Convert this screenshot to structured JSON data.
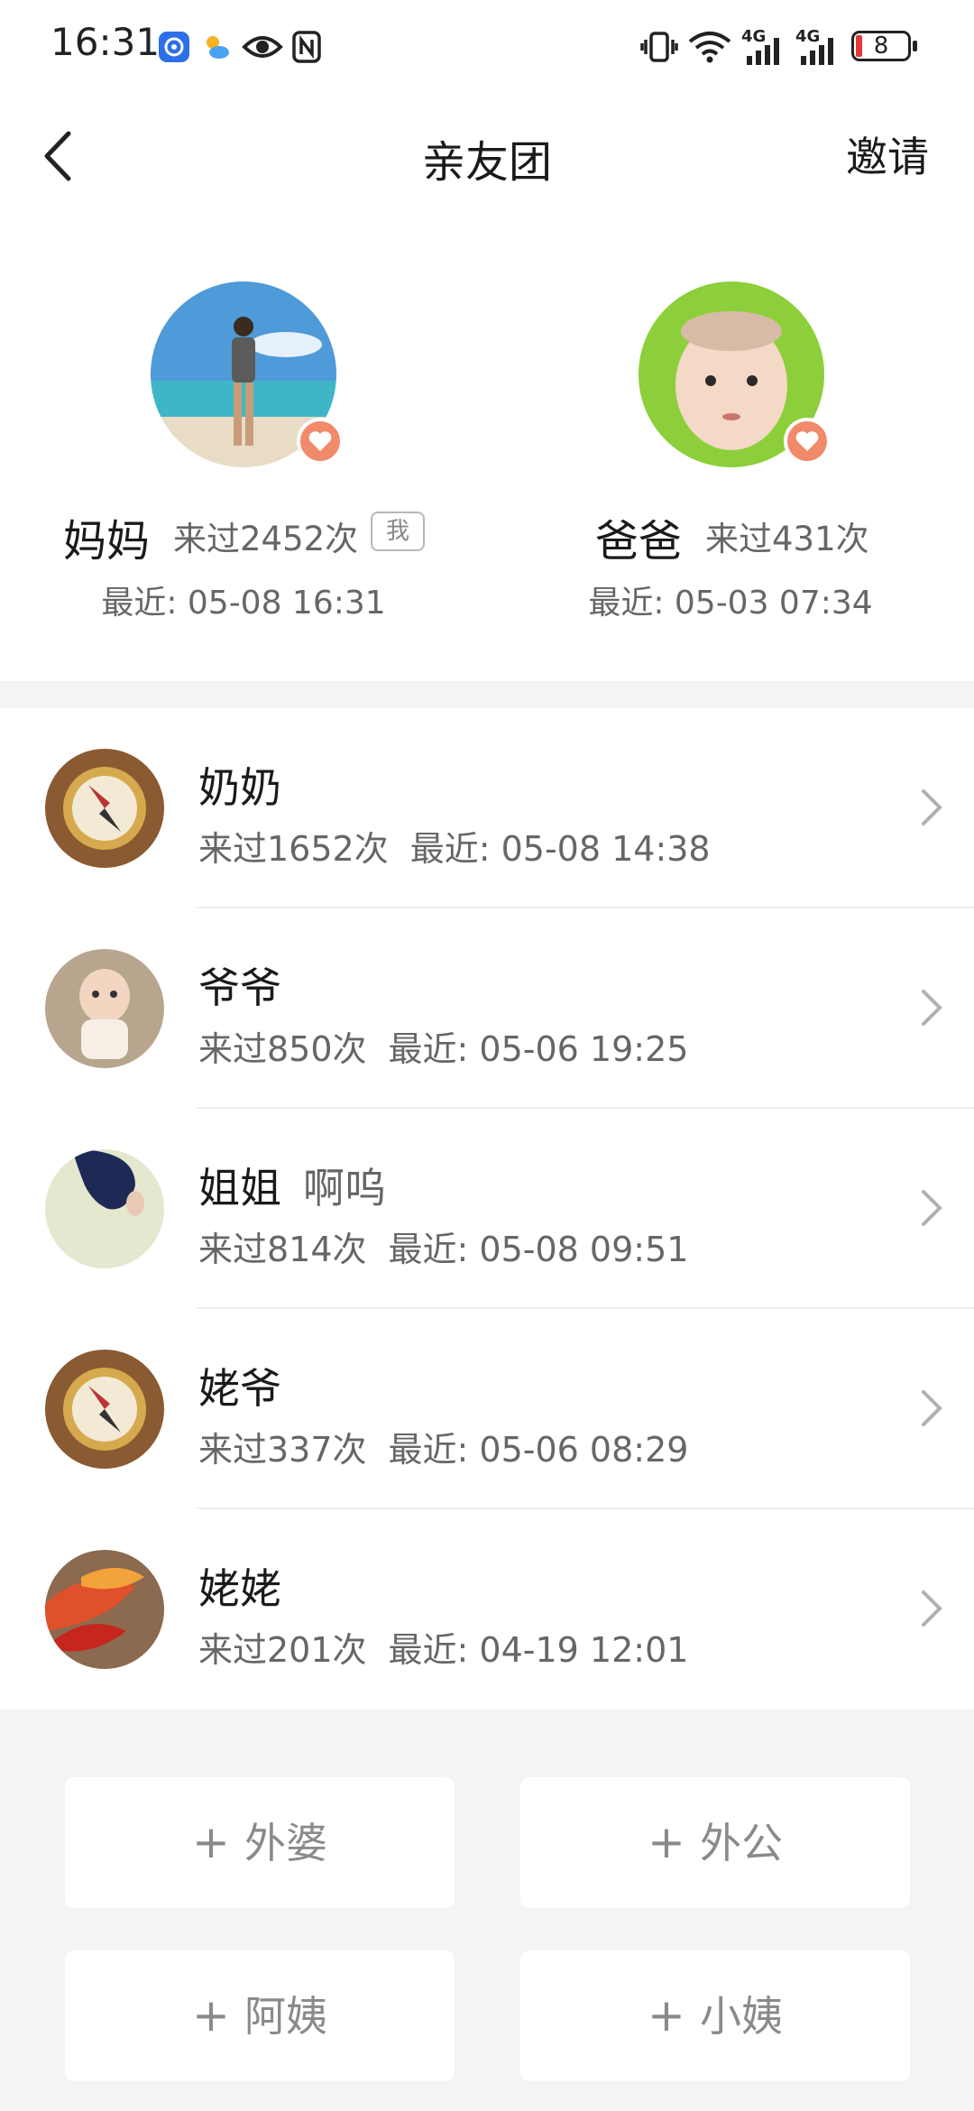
{
  "status_bar": {
    "time": "16:31",
    "icons": [
      "app-badge-icon",
      "weather-icon",
      "eye-icon",
      "nfc-icon",
      "vibrate-icon",
      "wifi-icon",
      "signal-4g-icon",
      "signal-4g-icon",
      "battery-icon"
    ],
    "network1": "4G",
    "network2": "4G",
    "battery": "8"
  },
  "header": {
    "title": "亲友团",
    "invite_label": "邀请"
  },
  "parents": [
    {
      "name": "妈妈",
      "count": "来过2452次",
      "tag": "我",
      "recent": "最近: 05-08 16:31"
    },
    {
      "name": "爸爸",
      "count": "来过431次",
      "recent": "最近: 05-03 07:34"
    }
  ],
  "members": [
    {
      "name": "奶奶",
      "nickname": "",
      "count": "来过1652次",
      "recent": "最近: 05-08 14:38"
    },
    {
      "name": "爷爷",
      "nickname": "",
      "count": "来过850次",
      "recent": "最近: 05-06 19:25"
    },
    {
      "name": "姐姐",
      "nickname": "啊呜",
      "count": "来过814次",
      "recent": "最近: 05-08 09:51"
    },
    {
      "name": "姥爷",
      "nickname": "",
      "count": "来过337次",
      "recent": "最近: 05-06 08:29"
    },
    {
      "name": "姥姥",
      "nickname": "",
      "count": "来过201次",
      "recent": "最近: 04-19 12:01"
    }
  ],
  "add_buttons": [
    {
      "plus": "+",
      "label": "外婆"
    },
    {
      "plus": "+",
      "label": "外公"
    },
    {
      "plus": "+",
      "label": "阿姨"
    },
    {
      "plus": "+",
      "label": "小姨"
    }
  ],
  "colors": {
    "heart": "#f08a6a",
    "page_bg": "#f4f4f4",
    "card_bg": "#ffffff"
  }
}
